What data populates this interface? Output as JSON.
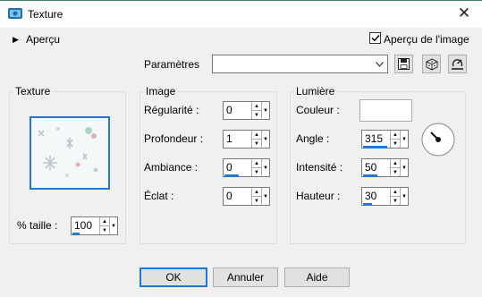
{
  "window": {
    "title": "Texture",
    "close_glyph": "✕"
  },
  "preview_section": {
    "label": "Aperçu",
    "toggle_glyph": "▶"
  },
  "preview_checkbox": {
    "label": "Aperçu de l'image",
    "checked": true
  },
  "params": {
    "label": "Paramètres",
    "value": ""
  },
  "texture_group": {
    "title": "Texture",
    "size_label": "% taille :",
    "size_value": "100",
    "size_level": 0.25
  },
  "image_group": {
    "title": "Image",
    "fields": [
      {
        "label": "Régularité :",
        "value": "0",
        "level": 0
      },
      {
        "label": "Profondeur :",
        "value": "1",
        "level": 0
      },
      {
        "label": "Ambiance :",
        "value": "0",
        "level": 0.5
      },
      {
        "label": "Éclat :",
        "value": "0",
        "level": 0
      }
    ]
  },
  "light_group": {
    "title": "Lumière",
    "color_label": "Couleur :",
    "color_value": "#ffffff",
    "angle_label": "Angle :",
    "angle_value": "315",
    "angle_level": 0.875,
    "intensity_label": "Intensité :",
    "intensity_value": "50",
    "intensity_level": 0.5,
    "height_label": "Hauteur :",
    "height_value": "30",
    "height_level": 0.33
  },
  "buttons": {
    "ok": "OK",
    "cancel": "Annuler",
    "help": "Aide"
  },
  "colors": {
    "accent": "#1e78d7",
    "dialog_bg": "#f0f0f0",
    "group_border": "#d5dfe5"
  }
}
